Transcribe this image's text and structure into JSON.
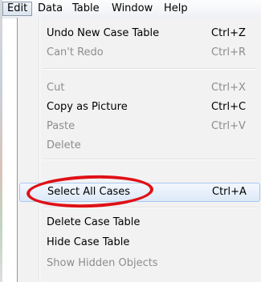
{
  "menubar": {
    "items": [
      {
        "label": "Edit",
        "active": true
      },
      {
        "label": "Data"
      },
      {
        "label": "Table"
      },
      {
        "label": "Window"
      },
      {
        "label": "Help"
      }
    ]
  },
  "edit_menu": {
    "items": [
      {
        "label": "Undo New Case Table",
        "shortcut": "Ctrl+Z",
        "enabled": true
      },
      {
        "label": "Can't Redo",
        "shortcut": "Ctrl+R",
        "enabled": false
      },
      {
        "label": "Cut",
        "shortcut": "Ctrl+X",
        "enabled": false
      },
      {
        "label": "Copy as Picture",
        "shortcut": "Ctrl+C",
        "enabled": true
      },
      {
        "label": "Paste",
        "shortcut": "Ctrl+V",
        "enabled": false
      },
      {
        "label": "Delete",
        "shortcut": "",
        "enabled": false
      },
      {
        "label": "Select All Cases",
        "shortcut": "Ctrl+A",
        "enabled": true,
        "highlighted": true,
        "circled": true
      },
      {
        "label": "Delete Case Table",
        "shortcut": "",
        "enabled": true
      },
      {
        "label": "Hide Case Table",
        "shortcut": "",
        "enabled": true
      },
      {
        "label": "Show Hidden Objects",
        "shortcut": "",
        "enabled": false
      }
    ]
  },
  "colors": {
    "annotation_circle": "#e01016",
    "highlight_border": "#a9c9ef",
    "disabled_text": "#8d8d8d"
  }
}
